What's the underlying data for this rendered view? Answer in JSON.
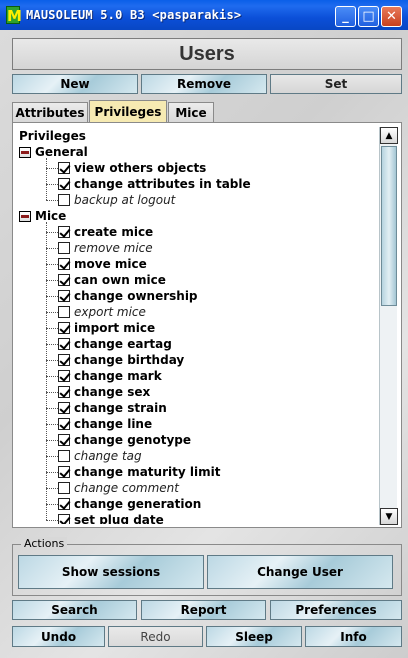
{
  "window": {
    "title": "MAUSOLEUM 5.0 B3 <pasparakis>",
    "app_icon": "M"
  },
  "heading": "Users",
  "toolbar": {
    "new": "New",
    "remove": "Remove",
    "set": "Set"
  },
  "tabs": [
    {
      "label": "Attributes",
      "active": false
    },
    {
      "label": "Privileges",
      "active": true
    },
    {
      "label": "Mice",
      "active": false
    }
  ],
  "tree": {
    "root": "Privileges",
    "groups": [
      {
        "label": "General",
        "items": [
          {
            "label": "view others objects",
            "checked": true
          },
          {
            "label": "change attributes in table",
            "checked": true
          },
          {
            "label": "backup at logout",
            "checked": false
          }
        ]
      },
      {
        "label": "Mice",
        "items": [
          {
            "label": "create mice",
            "checked": true
          },
          {
            "label": "remove mice",
            "checked": false
          },
          {
            "label": "move mice",
            "checked": true
          },
          {
            "label": "can own mice",
            "checked": true
          },
          {
            "label": "change ownership",
            "checked": true
          },
          {
            "label": "export mice",
            "checked": false
          },
          {
            "label": "import mice",
            "checked": true
          },
          {
            "label": "change eartag",
            "checked": true
          },
          {
            "label": "change birthday",
            "checked": true
          },
          {
            "label": "change mark",
            "checked": true
          },
          {
            "label": "change sex",
            "checked": true
          },
          {
            "label": "change strain",
            "checked": true
          },
          {
            "label": "change line",
            "checked": true
          },
          {
            "label": "change genotype",
            "checked": true
          },
          {
            "label": "change tag",
            "checked": false
          },
          {
            "label": "change maturity limit",
            "checked": true
          },
          {
            "label": "change comment",
            "checked": false
          },
          {
            "label": "change generation",
            "checked": true
          },
          {
            "label": "set plug date",
            "checked": true
          }
        ]
      }
    ]
  },
  "actions": {
    "label": "Actions",
    "show_sessions": "Show sessions",
    "change_user": "Change User"
  },
  "bottom": {
    "search": "Search",
    "report": "Report",
    "preferences": "Preferences",
    "undo": "Undo",
    "redo": "Redo",
    "sleep": "Sleep",
    "info": "Info"
  }
}
